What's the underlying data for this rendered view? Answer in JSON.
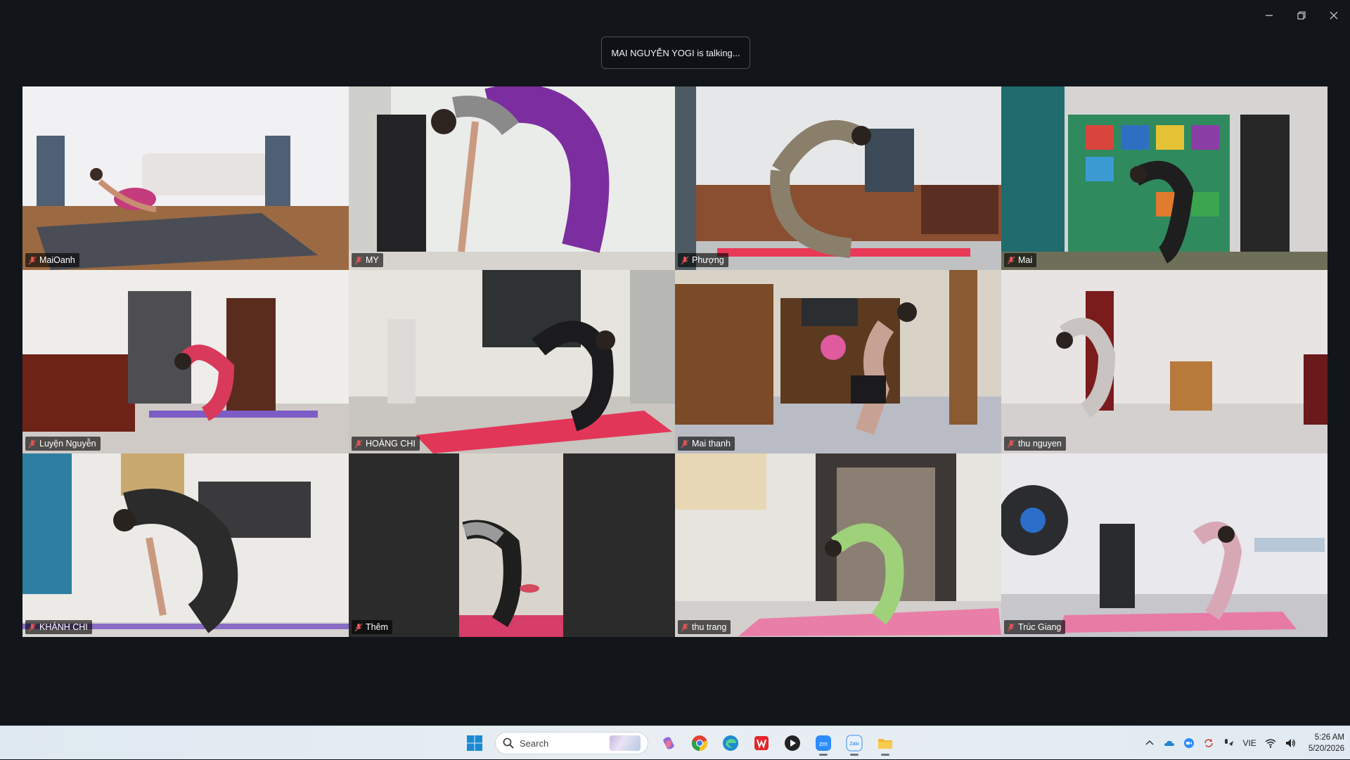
{
  "window": {
    "controls": [
      "minimize-icon",
      "restore-icon",
      "close-icon"
    ]
  },
  "banner": {
    "talking": "MAI NGUYỄN YOGI is talking..."
  },
  "participants": [
    {
      "name": "MaiOanh"
    },
    {
      "name": "MY"
    },
    {
      "name": "Phượng"
    },
    {
      "name": "Mai"
    },
    {
      "name": "Luyện Nguyễn"
    },
    {
      "name": "HOÀNG CHI"
    },
    {
      "name": "Mai thanh"
    },
    {
      "name": "thu nguyen"
    },
    {
      "name": "KHÁNH CHI"
    },
    {
      "name": "Thêm"
    },
    {
      "name": "thu trang"
    },
    {
      "name": "Trúc Giang"
    }
  ],
  "taskbar": {
    "search_placeholder": "Search",
    "apps": [
      "windows-start-icon",
      "copilot-icon",
      "chrome-icon",
      "edge-icon",
      "wps-office-icon",
      "media-player-icon",
      "zoom-icon",
      "zalo-icon",
      "file-explorer-icon"
    ],
    "zalo_label": "Zalo",
    "zoom_label": "zm",
    "language": "VIE",
    "time": "5:26 AM",
    "date": "5/20/2026"
  }
}
